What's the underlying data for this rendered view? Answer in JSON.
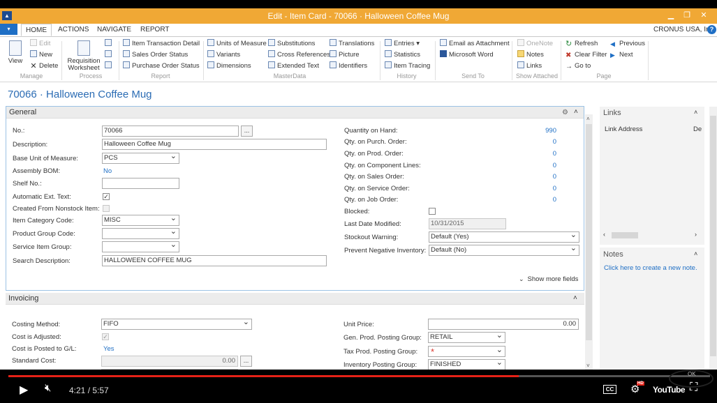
{
  "window": {
    "title": "Edit - Item Card - 70066 · Halloween Coffee Mug",
    "logo_text": "▲"
  },
  "ribbon_tabs": {
    "file": "▾",
    "tabs": [
      "HOME",
      "ACTIONS",
      "NAVIGATE",
      "REPORT"
    ],
    "company": "CRONUS USA, Inc."
  },
  "ribbon": {
    "manage": {
      "view": "View",
      "edit": "Edit",
      "new": "New",
      "delete": "Delete",
      "label": "Manage"
    },
    "process": {
      "requisition": "Requisition",
      "worksheet": "Worksheet",
      "label": "Process"
    },
    "report": {
      "items": [
        "Item Transaction Detail",
        "Sales Order Status",
        "Purchase Order Status"
      ],
      "label": "Report"
    },
    "masterdata": {
      "col1": [
        "Units of Measure",
        "Variants",
        "Dimensions"
      ],
      "col2": [
        "Substitutions",
        "Cross References",
        "Extended Text"
      ],
      "col3": [
        "Translations",
        "Picture",
        "Identifiers"
      ],
      "label": "MasterData"
    },
    "history": {
      "items": [
        "Entries ▾",
        "Statistics",
        "Item Tracing"
      ],
      "label": "History"
    },
    "sendto": {
      "items": [
        "Email as Attachment",
        "Microsoft Word"
      ],
      "label": "Send To"
    },
    "attached": {
      "items": [
        "OneNote",
        "Notes",
        "Links"
      ],
      "label": "Show Attached"
    },
    "page": {
      "col1": [
        "Refresh",
        "Clear Filter",
        "Go to"
      ],
      "col2": [
        "Previous",
        "Next"
      ],
      "label": "Page"
    }
  },
  "page_title": "70066 · Halloween Coffee Mug",
  "general": {
    "header": "General",
    "no_label": "No.:",
    "no_value": "70066",
    "desc_label": "Description:",
    "desc_value": "Halloween Coffee Mug",
    "base_uom_label": "Base Unit of Measure:",
    "base_uom_value": "PCS",
    "assembly_label": "Assembly BOM:",
    "assembly_value": "No",
    "shelf_label": "Shelf No.:",
    "auto_ext_label": "Automatic Ext. Text:",
    "auto_ext_value": "✓",
    "nonstock_label": "Created From Nonstock Item:",
    "category_label": "Item Category Code:",
    "category_value": "MISC",
    "product_group_label": "Product Group Code:",
    "service_group_label": "Service Item Group:",
    "search_desc_label": "Search Description:",
    "search_desc_value": "HALLOWEEN COFFEE MUG",
    "qoh_label": "Quantity on Hand:",
    "qoh_value": "990",
    "purch_label": "Qty. on Purch. Order:",
    "purch_value": "0",
    "prod_label": "Qty. on Prod. Order:",
    "prod_value": "0",
    "comp_label": "Qty. on Component Lines:",
    "comp_value": "0",
    "sales_label": "Qty. on Sales Order:",
    "sales_value": "0",
    "service_label": "Qty. on Service Order:",
    "service_value": "0",
    "job_label": "Qty. on Job Order:",
    "job_value": "0",
    "blocked_label": "Blocked:",
    "modified_label": "Last Date Modified:",
    "modified_value": "10/31/2015",
    "stockout_label": "Stockout Warning:",
    "stockout_value": "Default (Yes)",
    "negative_label": "Prevent Negative Inventory:",
    "negative_value": "Default (No)",
    "show_more": "Show more fields"
  },
  "invoicing": {
    "header": "Invoicing",
    "costing_label": "Costing Method:",
    "costing_value": "FIFO",
    "adjusted_label": "Cost is Adjusted:",
    "adjusted_value": "✓",
    "posted_label": "Cost is Posted to G/L:",
    "posted_value": "Yes",
    "std_cost_label": "Standard Cost:",
    "std_cost_value": "0.00",
    "unit_price_label": "Unit Price:",
    "unit_price_value": "0.00",
    "gen_prod_label": "Gen. Prod. Posting Group:",
    "gen_prod_value": "RETAIL",
    "tax_prod_label": "Tax Prod. Posting Group:",
    "tax_prod_value": "*",
    "inv_posting_label": "Inventory Posting Group:",
    "inv_posting_value": "FINISHED"
  },
  "links": {
    "header": "Links",
    "col1": "Link Address",
    "col2": "De"
  },
  "notes": {
    "header": "Notes",
    "link": "Click here to create a new note."
  },
  "video": {
    "time": "4:21 / 5:57",
    "progress": 0.727,
    "cc": "CC",
    "hd": "HD",
    "brand": "YouTube",
    "ok_text": "OK"
  },
  "colors": {
    "titlebar": "#f0a835",
    "link_blue": "#1f6fc5",
    "progress_red": "#e62117"
  }
}
